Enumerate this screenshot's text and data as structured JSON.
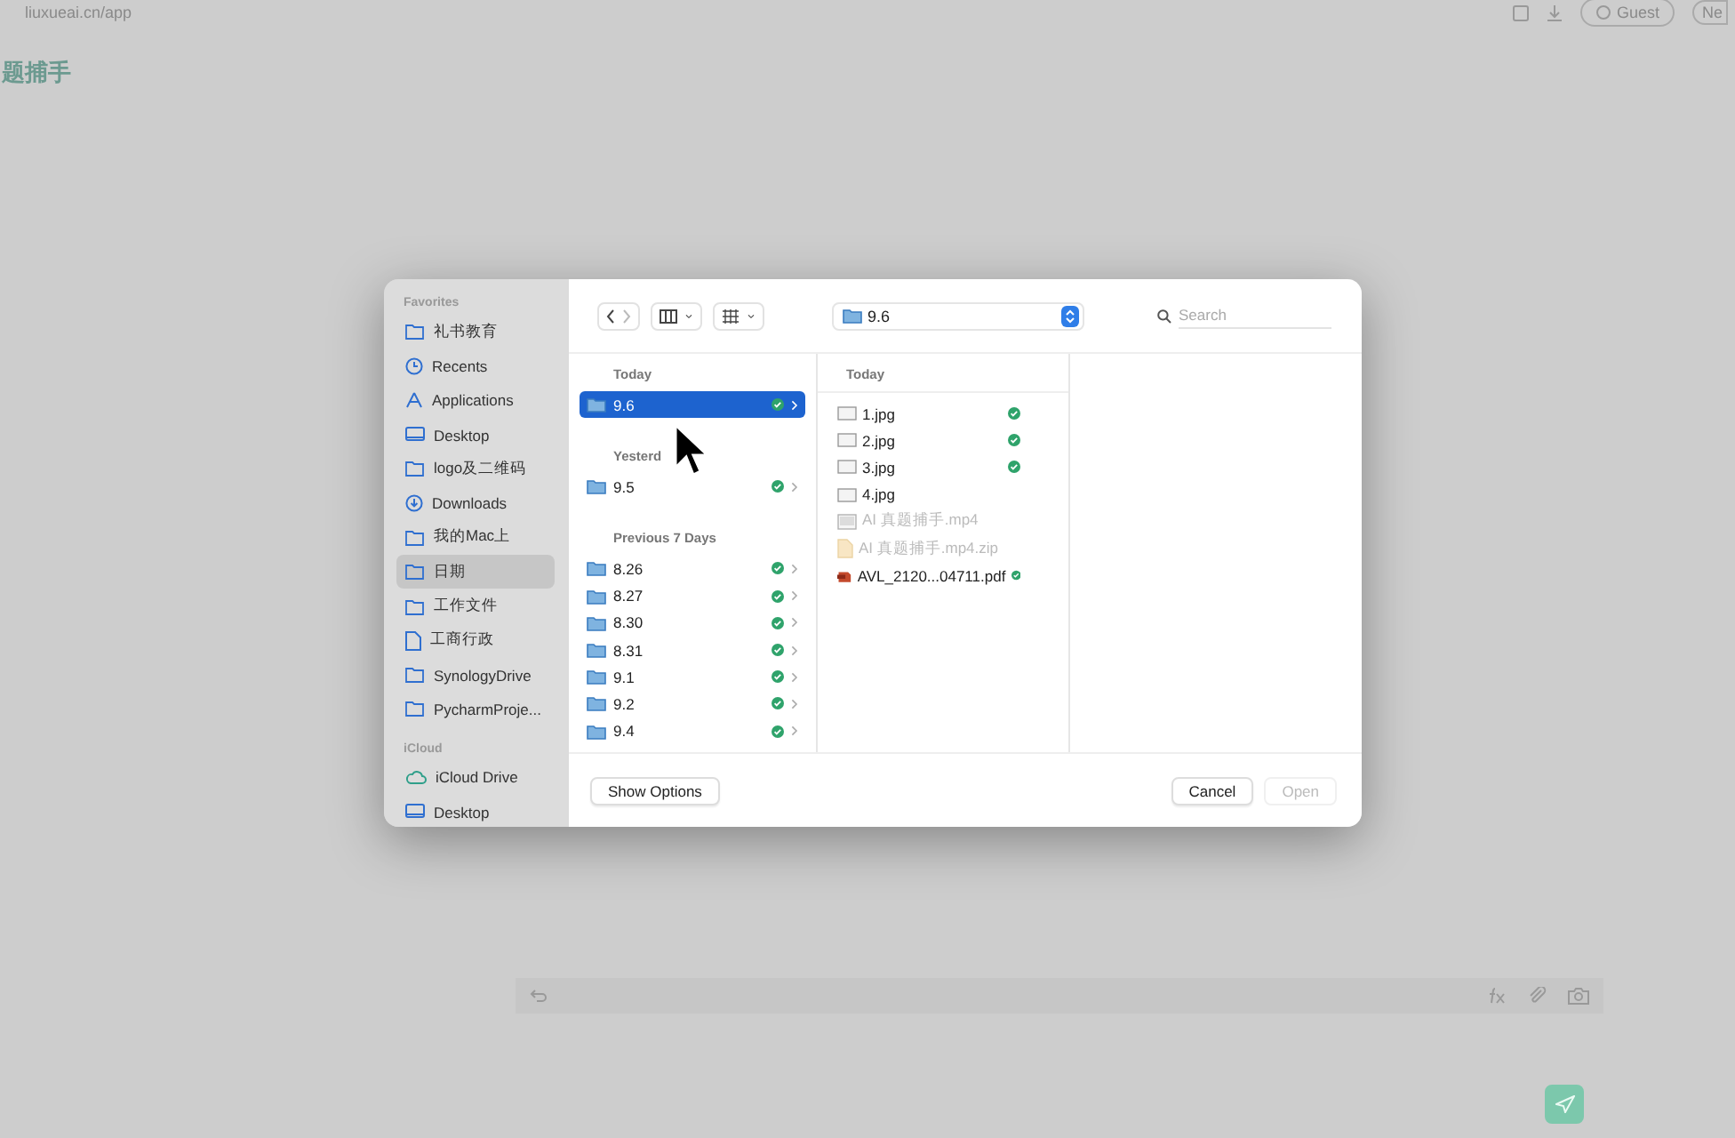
{
  "browser": {
    "url": "liuxueai.cn/app",
    "user": "Guest",
    "next_button": "Ne"
  },
  "app": {
    "title": "题捕手"
  },
  "dialog": {
    "sidebar": [
      {
        "heading": "Favorites",
        "items": [
          {
            "label": "礼书教育",
            "kind": "folder",
            "selected": false
          },
          {
            "label": "Recents",
            "kind": "recents",
            "selected": false
          },
          {
            "label": "Applications",
            "kind": "applications",
            "selected": false
          },
          {
            "label": "Desktop",
            "kind": "desktop",
            "selected": false
          },
          {
            "label": "logo及二维码",
            "kind": "folder",
            "selected": false
          },
          {
            "label": "Downloads",
            "kind": "downloads",
            "selected": false
          },
          {
            "label": "我的Mac上",
            "kind": "folder",
            "selected": false
          },
          {
            "label": "日期",
            "kind": "folder",
            "selected": true
          },
          {
            "label": "工作文件",
            "kind": "folder",
            "selected": false
          },
          {
            "label": "工商行政",
            "kind": "document",
            "selected": false
          },
          {
            "label": "SynologyDrive",
            "kind": "folder",
            "selected": false
          },
          {
            "label": "PycharmProje...",
            "kind": "folder",
            "selected": false
          }
        ]
      },
      {
        "heading": "iCloud",
        "items": [
          {
            "label": "iCloud Drive",
            "kind": "cloud",
            "selected": false
          },
          {
            "label": "Desktop",
            "kind": "desktop",
            "selected": false
          }
        ]
      }
    ],
    "toolbar": {
      "location": "9.6",
      "search_placeholder": "Search"
    },
    "column_1": [
      {
        "heading": "Today",
        "items": [
          {
            "name": "9.6",
            "selected": true
          }
        ]
      },
      {
        "heading": "Yesterd",
        "items": [
          {
            "name": "9.5",
            "selected": false
          }
        ]
      },
      {
        "heading": "Previous 7 Days",
        "items": [
          {
            "name": "8.26",
            "selected": false
          },
          {
            "name": "8.27",
            "selected": false
          },
          {
            "name": "8.30",
            "selected": false
          },
          {
            "name": "8.31",
            "selected": false
          },
          {
            "name": "9.1",
            "selected": false
          },
          {
            "name": "9.2",
            "selected": false
          },
          {
            "name": "9.4",
            "selected": false
          }
        ]
      }
    ],
    "column_2": {
      "heading": "Today",
      "items": [
        {
          "name": "1.jpg",
          "kind": "image",
          "synced": true,
          "disabled": false
        },
        {
          "name": "2.jpg",
          "kind": "image",
          "synced": true,
          "disabled": false
        },
        {
          "name": "3.jpg",
          "kind": "image",
          "synced": true,
          "disabled": false
        },
        {
          "name": "4.jpg",
          "kind": "image",
          "synced": false,
          "disabled": false
        },
        {
          "name": "AI 真题捕手.mp4",
          "kind": "video",
          "synced": false,
          "disabled": true
        },
        {
          "name": "AI 真题捕手.mp4.zip",
          "kind": "archive",
          "synced": false,
          "disabled": true
        },
        {
          "name": "AVL_2120...04711.pdf",
          "kind": "pdf",
          "synced": true,
          "disabled": false
        }
      ]
    },
    "buttons": [
      {
        "label": "Show Options",
        "kind": "secondary",
        "disabled": false
      },
      {
        "label": "Cancel",
        "kind": "default",
        "disabled": false
      },
      {
        "label": "Open",
        "kind": "default",
        "disabled": true
      }
    ]
  }
}
